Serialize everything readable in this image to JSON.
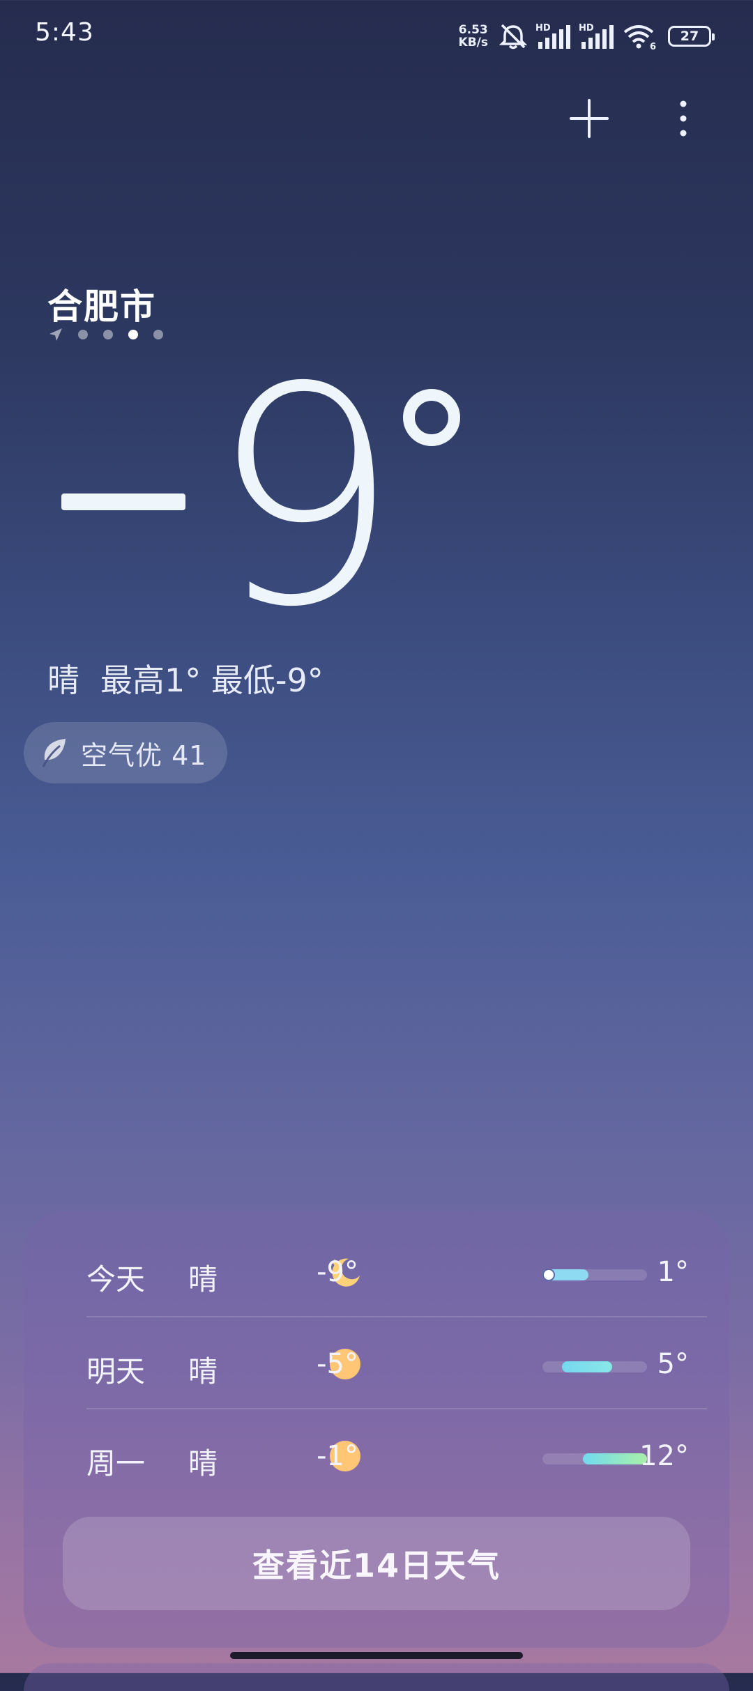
{
  "status_bar": {
    "time": "5:43",
    "net_speed_value": "6.53",
    "net_speed_unit": "KB/s",
    "sim1_label": "HD",
    "sim2_label": "HD",
    "wifi_label": "6",
    "battery": "27"
  },
  "location": {
    "city": "合肥市",
    "page_count": 5,
    "active_page": 4
  },
  "current": {
    "temperature_sign": "−",
    "temperature_digit": "9",
    "condition": "晴",
    "high": "最高1°",
    "low": "最低-9°",
    "air_quality": "空气优 41"
  },
  "forecast": {
    "rows": [
      {
        "day": "今天",
        "condition": "晴",
        "icon": "moon-icon",
        "low": "-9°",
        "high": "1°"
      },
      {
        "day": "明天",
        "condition": "晴",
        "icon": "sun-icon",
        "low": "-5°",
        "high": "5°"
      },
      {
        "day": "周一",
        "condition": "晴",
        "icon": "sun-icon",
        "low": "-1°",
        "high": "12°"
      }
    ],
    "button_label": "查看近14日天气"
  },
  "colors": {
    "moon": "#ffd27a",
    "sun": "#ffc676",
    "range_cool": "#7fe0f5",
    "range_warm": "#a8f0a8"
  }
}
